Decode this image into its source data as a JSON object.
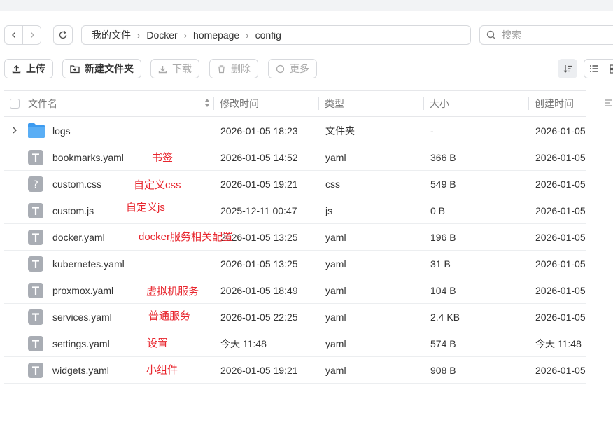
{
  "nav": {
    "breadcrumbs": [
      "我的文件",
      "Docker",
      "homepage",
      "config"
    ],
    "search_placeholder": "搜索"
  },
  "toolbar": {
    "upload": "上传",
    "new_folder": "新建文件夹",
    "download": "下载",
    "delete": "删除",
    "more": "更多"
  },
  "table": {
    "headers": {
      "name": "文件名",
      "modified": "修改时间",
      "type": "类型",
      "size": "大小",
      "created": "创建时间"
    },
    "rows": [
      {
        "name": "logs",
        "modified": "2026-01-05 18:23",
        "type": "文件夹",
        "size": "-",
        "created": "2026-01-05",
        "icon": "folder-icon",
        "annotation": ""
      },
      {
        "name": "bookmarks.yaml",
        "modified": "2026-01-05 14:52",
        "type": "yaml",
        "size": "366 B",
        "created": "2026-01-05",
        "icon": "text-file-icon",
        "annotation": "书签"
      },
      {
        "name": "custom.css",
        "modified": "2026-01-05 19:21",
        "type": "css",
        "size": "549 B",
        "created": "2026-01-05",
        "icon": "unknown-file-icon",
        "annotation": "自定义css"
      },
      {
        "name": "custom.js",
        "modified": "2025-12-11 00:47",
        "type": "js",
        "size": "0 B",
        "created": "2026-01-05",
        "icon": "text-file-icon",
        "annotation": "自定义js"
      },
      {
        "name": "docker.yaml",
        "modified": "2026-01-05 13:25",
        "type": "yaml",
        "size": "196 B",
        "created": "2026-01-05",
        "icon": "text-file-icon",
        "annotation": "docker服务相关配置"
      },
      {
        "name": "kubernetes.yaml",
        "modified": "2026-01-05 13:25",
        "type": "yaml",
        "size": "31 B",
        "created": "2026-01-05",
        "icon": "text-file-icon",
        "annotation": ""
      },
      {
        "name": "proxmox.yaml",
        "modified": "2026-01-05 18:49",
        "type": "yaml",
        "size": "104 B",
        "created": "2026-01-05",
        "icon": "text-file-icon",
        "annotation": "虚拟机服务"
      },
      {
        "name": "services.yaml",
        "modified": "2026-01-05 22:25",
        "type": "yaml",
        "size": "2.4 KB",
        "created": "2026-01-05",
        "icon": "text-file-icon",
        "annotation": "普通服务"
      },
      {
        "name": "settings.yaml",
        "modified": "今天 11:48",
        "type": "yaml",
        "size": "574 B",
        "created": "今天 11:48",
        "icon": "text-file-icon",
        "annotation": "设置"
      },
      {
        "name": "widgets.yaml",
        "modified": "2026-01-05 19:21",
        "type": "yaml",
        "size": "908 B",
        "created": "2026-01-05",
        "icon": "text-file-icon",
        "annotation": "小组件"
      }
    ]
  },
  "colors": {
    "annotation": "#e8262e",
    "folder": "#3d9bf0",
    "file_icon": "#a9adb4"
  }
}
